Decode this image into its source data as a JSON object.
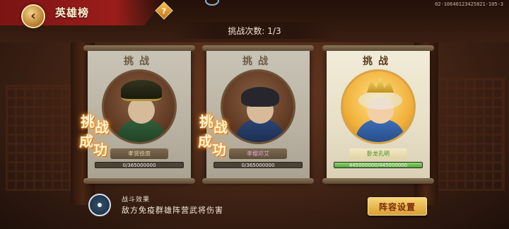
{
  "header": {
    "title": "英雄榜",
    "back_icon": "arrow-left-icon",
    "help_label": "?",
    "build_id": "02-10640123425821-105-3"
  },
  "challenge": {
    "count_text": "挑战次数: 1/3"
  },
  "cards": [
    {
      "head": "挑战",
      "name": "孝贤徐庶",
      "name_color": "#e4d6a8",
      "hp_text": "0/365000000",
      "hp_fraction": 0,
      "status": "won",
      "stamp": [
        "挑",
        "战",
        "成",
        "功"
      ]
    },
    {
      "head": "挑战",
      "name": "孝樱邓艾",
      "name_color": "#e2a2d4",
      "hp_text": "0/365000000",
      "hp_fraction": 0,
      "status": "won",
      "stamp": [
        "挑",
        "战",
        "成",
        "功"
      ]
    },
    {
      "head": "挑战",
      "name": "卧龙孔明",
      "name_color": "#3f8a2a",
      "hp_text": "445000000/445000000",
      "hp_fraction": 1,
      "status": "active"
    }
  ],
  "footer": {
    "effect_title": "战斗效果",
    "effect_desc": "敌方免疫群雄阵营武将伤害",
    "formation_button": "阵容设置"
  }
}
